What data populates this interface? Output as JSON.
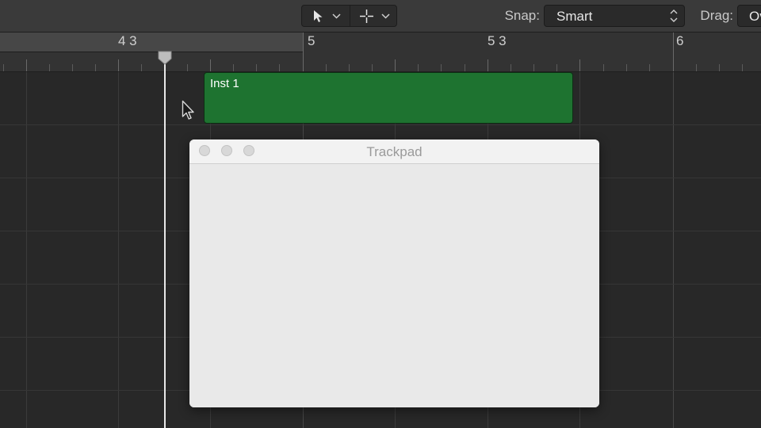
{
  "toolbar": {
    "pointer_tool_icon": "arrow-pointer-icon",
    "pencil_tool_icon": "crosshair-icon",
    "snap_label": "Snap:",
    "snap_value": "Smart",
    "drag_label": "Drag:",
    "drag_value": "Overlap"
  },
  "ruler": {
    "markers": [
      "4 3",
      "5",
      "5 3",
      "6"
    ]
  },
  "region": {
    "name": "Inst 1",
    "color": "#1e7330"
  },
  "playhead": {
    "color": "#e8e8e8"
  },
  "trackpad_window": {
    "title": "Trackpad"
  }
}
